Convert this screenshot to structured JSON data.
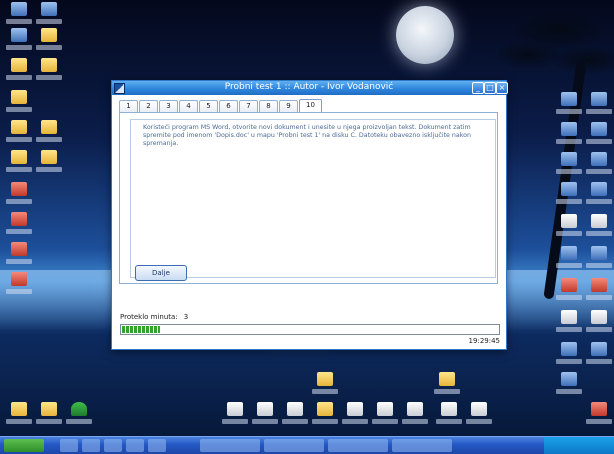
{
  "window": {
    "title": "Probni test 1 :: Autor - Ivor Vodanović",
    "minimize_label": "_",
    "maximize_label": "□",
    "close_label": "×"
  },
  "tabs": [
    {
      "label": "1"
    },
    {
      "label": "2"
    },
    {
      "label": "3"
    },
    {
      "label": "4"
    },
    {
      "label": "5"
    },
    {
      "label": "6"
    },
    {
      "label": "7"
    },
    {
      "label": "8"
    },
    {
      "label": "9"
    },
    {
      "label": "10"
    }
  ],
  "active_tab": "10",
  "question": {
    "text": "Koristeći program MS Word, otvorite novi dokument i unesite u njega proizvoljan tekst. Dokument zatim spremite pod imenom 'Dopis.doc' u mapu 'Probni test 1' na disku C. Datoteku obavezno isključite nakon spremanja."
  },
  "next_button": {
    "label": "Dalje"
  },
  "status": {
    "elapsed_label": "Proteklo minuta:",
    "elapsed_value": "3",
    "progress_fraction": 0.1,
    "clock": "19:29:45"
  },
  "colors": {
    "titlebar": "#2f86dd",
    "progress": "#33a52f",
    "question_text": "#4c6a94"
  }
}
